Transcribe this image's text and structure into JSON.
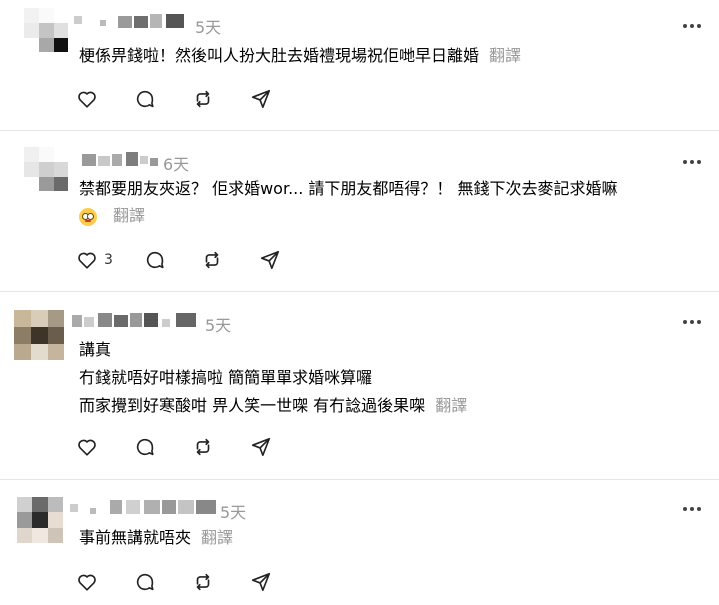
{
  "translate_label": "翻譯",
  "posts": [
    {
      "time": "5天",
      "lines": [
        "梗係畀錢啦！然後叫人扮大肚去婚禮現場祝佢哋早日離婚"
      ],
      "likes": ""
    },
    {
      "time": "6天",
      "lines": [
        "禁都要朋友夾返？ 佢求婚wor... 請下朋友都唔得？！ 無錢下次去麥記求婚嘛"
      ],
      "emoji": "rolling-eyes-emoji",
      "likes": "3"
    },
    {
      "time": "5天",
      "lines": [
        "講真",
        "冇錢就唔好咁樣搞啦 簡簡單單求婚咪算囉",
        "而家攪到好寒酸咁 畀人笑一世㗎 有冇諗過後果㗎"
      ],
      "likes": ""
    },
    {
      "time": "5天",
      "lines": [
        "事前無講就唔夾"
      ],
      "likes": ""
    }
  ],
  "icons": [
    "heart-icon",
    "comment-icon",
    "repost-icon",
    "share-icon",
    "more-icon"
  ]
}
